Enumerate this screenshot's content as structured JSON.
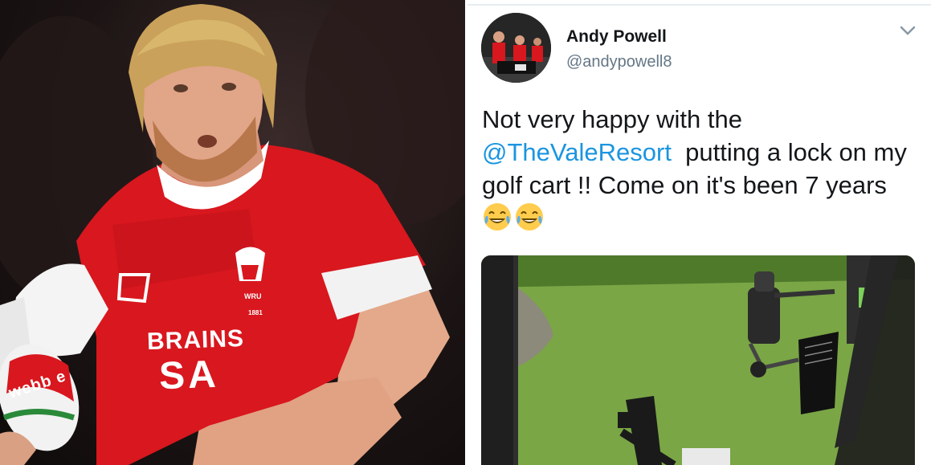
{
  "photo": {
    "shirt_sponsor_line1": "BRAINS",
    "shirt_sponsor_line2": "SA",
    "crest_text": "WRU",
    "crest_year": "1881",
    "ball_brand": "webb e"
  },
  "tweet": {
    "author": {
      "display_name": "Andy Powell",
      "handle": "@andypowell8",
      "avatar_icon": "profile-photo"
    },
    "menu_icon": "chevron-down-icon",
    "text": {
      "part1": "Not very happy with the ",
      "mention": "@TheValeResort",
      "part2": "  putting a lock on my golf cart !! Come on it's been 7 years ",
      "emoji_1": "joy-emoji",
      "emoji_2": "joy-emoji"
    },
    "media": {
      "description_icon": "golf-cart-photo"
    }
  },
  "colors": {
    "link": "#1b95e0",
    "text": "#14171a",
    "secondary": "#657786",
    "jersey_red": "#d9171e"
  }
}
